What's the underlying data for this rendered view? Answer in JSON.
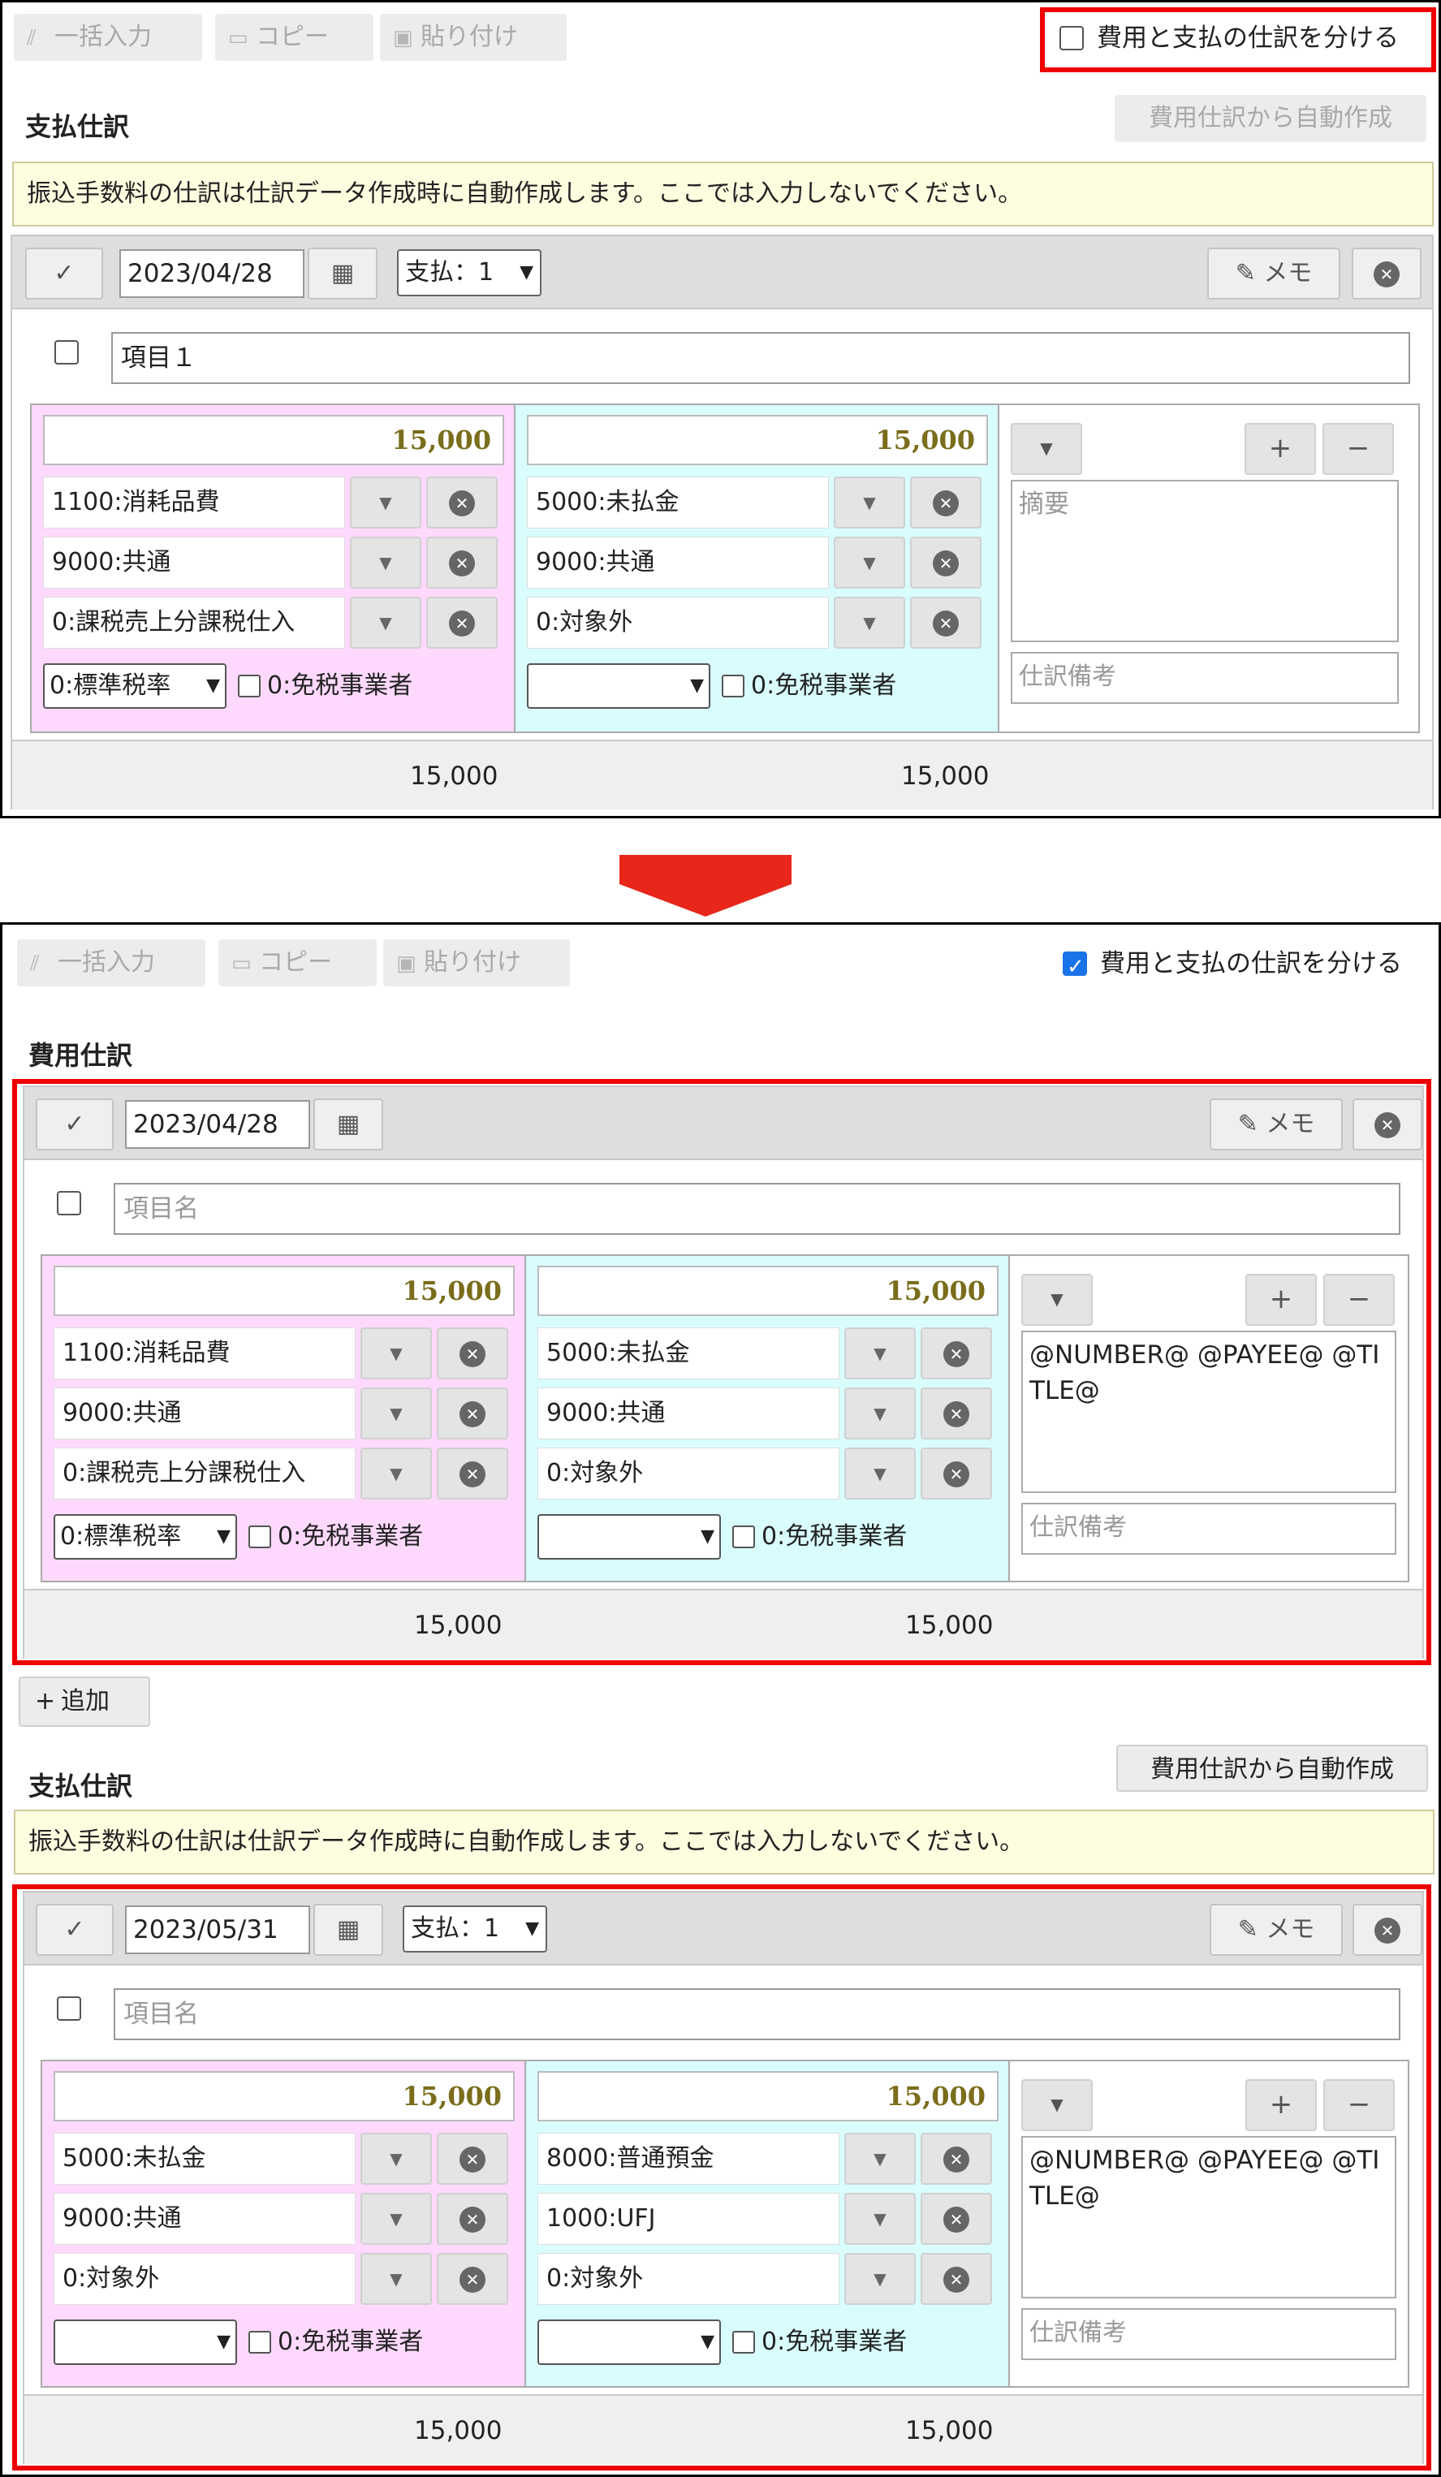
{
  "toolbar": {
    "bulk_input": "一括入力",
    "copy": "コピー",
    "paste": "貼り付け",
    "icons": {
      "bulk": "pen-stroke-icon",
      "copy": "copy-icon",
      "paste": "paste-icon"
    }
  },
  "separate_checkbox_label": "費用と支払の仕訳を分ける",
  "before": {
    "separate_checked": false,
    "section_title": "支払仕訳",
    "auto_create_label": "費用仕訳から自動作成",
    "notice": "振込手数料の仕訳は仕訳データ作成時に自動作成します。ここでは入力しないでください。",
    "entry": {
      "date": "2023/04/28",
      "type_select": "支払：1",
      "memo_btn": "メモ",
      "item_name": "項目１",
      "debit": {
        "amount": "15,000",
        "accounts": [
          "1100:消耗品費",
          "9000:共通",
          "0:課税売上分課税仕入"
        ],
        "tax_rate": "0:標準税率",
        "tax_exempt": "0:免税事業者"
      },
      "credit": {
        "amount": "15,000",
        "accounts": [
          "5000:未払金",
          "9000:共通",
          "0:対象外"
        ],
        "tax_rate": "",
        "tax_exempt": "0:免税事業者"
      },
      "summary_placeholder": "摘要",
      "notes_placeholder": "仕訳備考",
      "total_debit": "15,000",
      "total_credit": "15,000"
    }
  },
  "after": {
    "separate_checked": true,
    "expense_title": "費用仕訳",
    "expense_entry": {
      "date": "2023/04/28",
      "memo_btn": "メモ",
      "item_placeholder": "項目名",
      "debit": {
        "amount": "15,000",
        "accounts": [
          "1100:消耗品費",
          "9000:共通",
          "0:課税売上分課税仕入"
        ],
        "tax_rate": "0:標準税率",
        "tax_exempt": "0:免税事業者"
      },
      "credit": {
        "amount": "15,000",
        "accounts": [
          "5000:未払金",
          "9000:共通",
          "0:対象外"
        ],
        "tax_rate": "",
        "tax_exempt": "0:免税事業者"
      },
      "summary": "@NUMBER@ @PAYEE@ @TITLE@",
      "notes_placeholder": "仕訳備考",
      "total_debit": "15,000",
      "total_credit": "15,000"
    },
    "add_label": "追加",
    "payment_title": "支払仕訳",
    "auto_create_label": "費用仕訳から自動作成",
    "notice": "振込手数料の仕訳は仕訳データ作成時に自動作成します。ここでは入力しないでください。",
    "payment_entry": {
      "date": "2023/05/31",
      "type_select": "支払：1",
      "memo_btn": "メモ",
      "item_placeholder": "項目名",
      "debit": {
        "amount": "15,000",
        "accounts": [
          "5000:未払金",
          "9000:共通",
          "0:対象外"
        ],
        "tax_rate": "",
        "tax_exempt": "0:免税事業者"
      },
      "credit": {
        "amount": "15,000",
        "accounts": [
          "8000:普通預金",
          "1000:UFJ",
          "0:対象外"
        ],
        "tax_rate": "",
        "tax_exempt": "0:免税事業者"
      },
      "summary": "@NUMBER@ @PAYEE@ @TITLE@",
      "notes_placeholder": "仕訳備考",
      "total_debit": "15,000",
      "total_credit": "15,000"
    }
  },
  "colors": {
    "highlight": "#e00000",
    "arrow": "#e8261a",
    "debit_bg": "#ffd9fd",
    "credit_bg": "#d9fdfd",
    "amount_text": "#7a6d1c"
  }
}
